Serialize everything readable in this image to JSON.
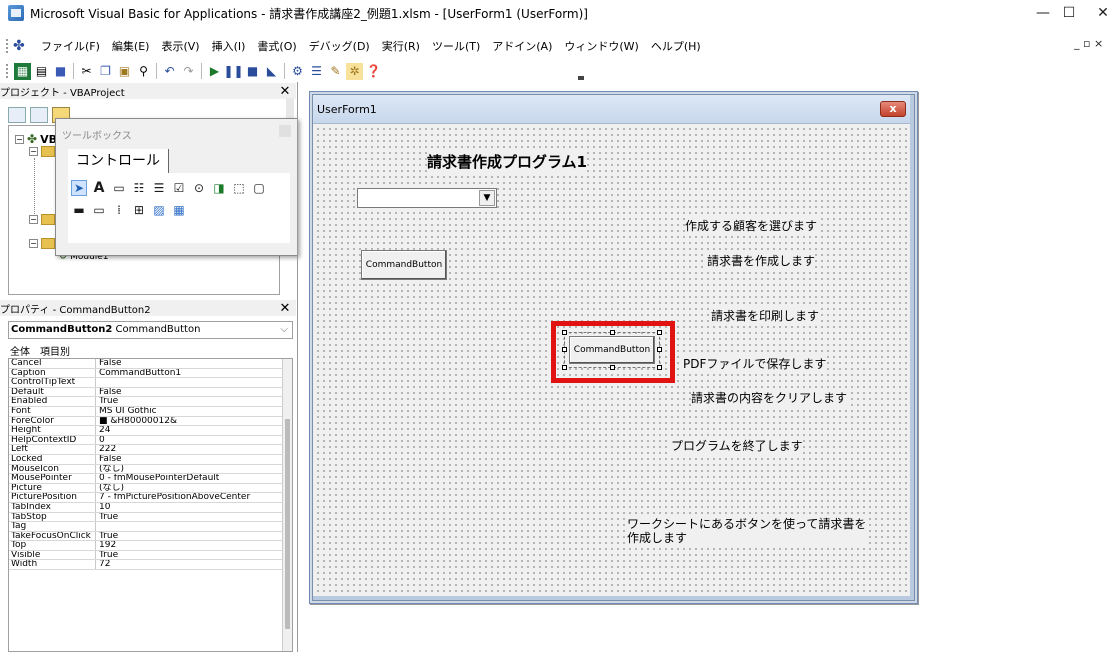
{
  "window": {
    "title": "Microsoft Visual Basic for Applications - 請求書作成講座2_例題1.xlsm - [UserForm1 (UserForm)]",
    "controls": {
      "minimize": "—",
      "maximize": "☐",
      "close": "✕"
    },
    "mdi_controls": "_ ▫ ×"
  },
  "menubar": {
    "items": [
      "ファイル(F)",
      "編集(E)",
      "表示(V)",
      "挿入(I)",
      "書式(O)",
      "デバッグ(D)",
      "実行(R)",
      "ツール(T)",
      "アドイン(A)",
      "ウィンドウ(W)",
      "ヘルプ(H)"
    ]
  },
  "toolbar": {
    "buttons": [
      "excel-icon",
      "insert-icon",
      "save-icon",
      "cut-icon",
      "copy-icon",
      "paste-icon",
      "find-icon",
      "undo-icon",
      "redo-icon",
      "run-icon",
      "break-icon",
      "reset-icon",
      "design-mode-icon",
      "project-explorer-icon",
      "properties-icon",
      "object-browser-icon",
      "toolbox-icon",
      "help-icon"
    ]
  },
  "project_pane": {
    "title": "プロジェクト - VBAProject",
    "root_label": "VB",
    "module_label": "Module1"
  },
  "toolbox": {
    "title": "ツールボックス",
    "tab_label": "コントロール"
  },
  "properties_pane": {
    "title": "プロパティ - CommandButton2",
    "object_name": "CommandButton2",
    "object_type": "CommandButton",
    "tabs": [
      "全体",
      "項目別"
    ],
    "rows": [
      {
        "name": "Cancel",
        "value": "False"
      },
      {
        "name": "Caption",
        "value": "CommandButton1"
      },
      {
        "name": "ControlTipText",
        "value": ""
      },
      {
        "name": "Default",
        "value": "False"
      },
      {
        "name": "Enabled",
        "value": "True"
      },
      {
        "name": "Font",
        "value": "MS UI Gothic"
      },
      {
        "name": "ForeColor",
        "value": "■ &H80000012&"
      },
      {
        "name": "Height",
        "value": "24"
      },
      {
        "name": "HelpContextID",
        "value": "0"
      },
      {
        "name": "Left",
        "value": "222"
      },
      {
        "name": "Locked",
        "value": "False"
      },
      {
        "name": "MouseIcon",
        "value": "(なし)"
      },
      {
        "name": "MousePointer",
        "value": "0 - fmMousePointerDefault"
      },
      {
        "name": "Picture",
        "value": "(なし)"
      },
      {
        "name": "PicturePosition",
        "value": "7 - fmPicturePositionAboveCenter"
      },
      {
        "name": "TabIndex",
        "value": "10"
      },
      {
        "name": "TabStop",
        "value": "True"
      },
      {
        "name": "Tag",
        "value": ""
      },
      {
        "name": "TakeFocusOnClick",
        "value": "True"
      },
      {
        "name": "Top",
        "value": "192"
      },
      {
        "name": "Visible",
        "value": "True"
      },
      {
        "name": "Width",
        "value": "72"
      }
    ]
  },
  "userform": {
    "title": "UserForm1",
    "close_label": "x",
    "heading": "請求書作成プログラム1",
    "labels": {
      "select_customer": "作成する顧客を選びます",
      "create_invoice": "請求書を作成します",
      "print_invoice": "請求書を印刷します",
      "save_pdf": "PDFファイルで保存します",
      "clear_invoice": "請求書の内容をクリアします",
      "exit_program": "プログラムを終了します",
      "worksheet_note": "ワークシートにあるボタンを使って請求書を作成します"
    },
    "buttons": {
      "command1": "CommandButton",
      "command2": "CommandButton"
    },
    "highlight_color": "#e11212"
  }
}
